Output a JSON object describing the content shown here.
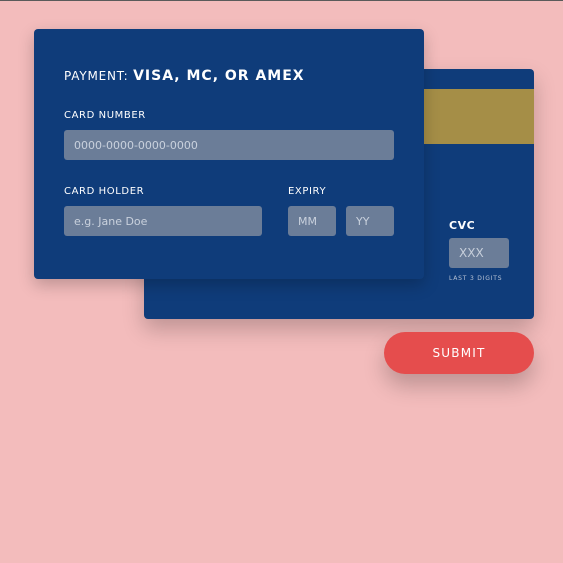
{
  "payment": {
    "label": "PAYMENT:",
    "methods": "VISA, MC, OR AMEX"
  },
  "card_number": {
    "label": "CARD NUMBER",
    "placeholder": "0000-0000-0000-0000"
  },
  "card_holder": {
    "label": "CARD HOLDER",
    "placeholder": "e.g. Jane Doe"
  },
  "expiry": {
    "label": "EXPIRY",
    "month_placeholder": "MM",
    "year_placeholder": "YY"
  },
  "cvc": {
    "label": "CVC",
    "placeholder": "XXX",
    "hint": "LAST 3 DIGITS"
  },
  "submit": {
    "label": "SUBMIT"
  },
  "colors": {
    "background": "#f3bcbc",
    "card": "#0f3c7a",
    "input": "#6b7d98",
    "stripe": "#a58e47",
    "submit": "#e54d4d"
  }
}
